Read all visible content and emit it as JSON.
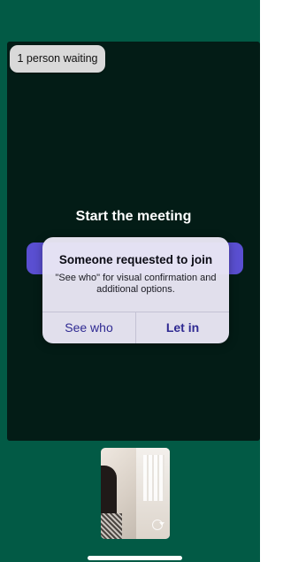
{
  "waiting_indicator": {
    "label": "1 person waiting"
  },
  "meeting": {
    "title": "Start the meeting"
  },
  "join_request_dialog": {
    "title": "Someone requested to join",
    "message": "\"See who\" for visual confirmation and additional options.",
    "buttons": {
      "see_who": "See who",
      "let_in": "Let in"
    }
  },
  "self_view": {
    "flip_camera_icon": "camera-flip-icon"
  },
  "colors": {
    "app_background": "#025a45",
    "stage_background": "#031c16",
    "accent_button": "#5a4fd1",
    "dialog_button_text": "#2f2a92"
  }
}
